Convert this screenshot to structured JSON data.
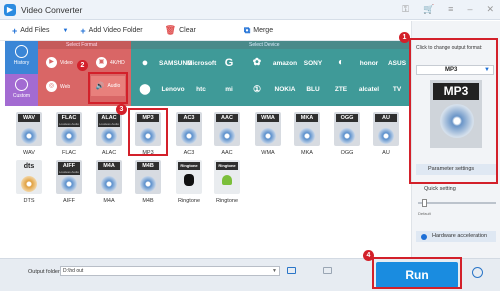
{
  "window": {
    "title": "Video Converter"
  },
  "toolbar": {
    "add_files": "Add Files",
    "add_video_folder": "Add Video Folder",
    "clear": "Clear",
    "merge": "Merge"
  },
  "sidebar": {
    "history": "History",
    "custom": "Custom"
  },
  "headers": {
    "select_format": "Select Format",
    "select_device": "Select Device"
  },
  "format_types": [
    {
      "label": "Video",
      "icon": "play-icon"
    },
    {
      "label": "4K/HD",
      "icon": "hd-icon"
    },
    {
      "label": "Web",
      "icon": "globe-icon"
    },
    {
      "label": "Audio",
      "icon": "speaker-icon"
    }
  ],
  "devices": {
    "row1": [
      "",
      "SAMSUNG",
      "Microsoft",
      "G",
      "",
      "amazon",
      "SONY",
      "",
      "honor",
      "ASUS"
    ],
    "row2": [
      "",
      "Lenovo",
      "htc",
      "mi",
      "",
      "NOKIA",
      "BLU",
      "ZTE",
      "alcatel",
      "TV"
    ]
  },
  "formats_row1": [
    {
      "name": "WAV",
      "tag": "WAV",
      "sub": ""
    },
    {
      "name": "FLAC",
      "tag": "FLAC",
      "sub": "Lossless Audio"
    },
    {
      "name": "ALAC",
      "tag": "ALAC",
      "sub": "Lossless Audio"
    },
    {
      "name": "MP3",
      "tag": "MP3",
      "sub": ""
    },
    {
      "name": "AC3",
      "tag": "AC3",
      "sub": ""
    },
    {
      "name": "AAC",
      "tag": "AAC",
      "sub": ""
    },
    {
      "name": "WMA",
      "tag": "WMA",
      "sub": ""
    },
    {
      "name": "MKA",
      "tag": "MKA",
      "sub": ""
    },
    {
      "name": "OGG",
      "tag": "OGG",
      "sub": ""
    },
    {
      "name": "AU",
      "tag": "AU",
      "sub": ""
    }
  ],
  "formats_row2": [
    {
      "name": "DTS",
      "tag": "dts",
      "sub": ""
    },
    {
      "name": "AIFF",
      "tag": "AIFF",
      "sub": "Lossless Audio"
    },
    {
      "name": "M4A",
      "tag": "M4A",
      "sub": ""
    },
    {
      "name": "M4B",
      "tag": "M4B",
      "sub": ""
    },
    {
      "name": "Ringtone",
      "tag": "Ringtone",
      "sub": ""
    },
    {
      "name": "Ringtone",
      "tag": "Ringtone",
      "sub": ""
    }
  ],
  "markers": [
    "1",
    "2",
    "3",
    "4"
  ],
  "right_panel": {
    "title": "Click to change output format:",
    "selected_format": "MP3",
    "preview_tag": "MP3",
    "parameter_settings": "Parameter settings",
    "quick_setting": "Quick setting",
    "default_label": "Default",
    "hardware_acceleration": "Hardware acceleration"
  },
  "bottom": {
    "output_folder_label": "Output folder:",
    "output_path": "D:\\hd out",
    "run": "Run"
  },
  "colors": {
    "format_panel": "#d96666",
    "device_panel": "#3f9a98",
    "history": "#3b86d6",
    "custom": "#a36bd2",
    "run": "#1a8ce0",
    "highlight": "#d3202a"
  }
}
